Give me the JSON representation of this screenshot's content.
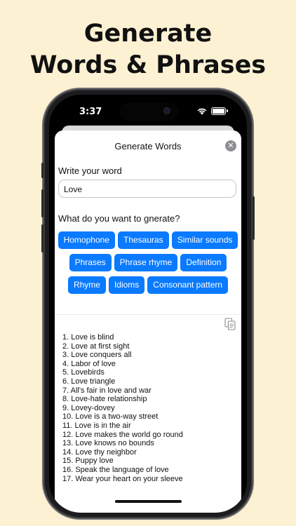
{
  "headline": {
    "line1": "Generate",
    "line2": "Words & Phrases"
  },
  "status_bar": {
    "time": "3:37",
    "icons": [
      "wifi-icon",
      "battery-icon"
    ]
  },
  "sheet": {
    "title": "Generate Words",
    "close_icon": "close-icon",
    "word_label": "Write your word",
    "word_value": "Love",
    "generate_label": "What do you want to gnerate?",
    "options_row1": [
      "Homophone",
      "Thesauras",
      "Similar sounds"
    ],
    "options_row2": [
      "Phrases",
      "Phrase rhyme",
      "Definition"
    ],
    "options_row3": [
      "Rhyme",
      "Idioms",
      "Consonant pattern"
    ],
    "copy_icon": "copy-icon",
    "results": [
      "1. Love is blind",
      "2. Love at first sight",
      "3. Love conquers all",
      "4. Labor of love",
      "5. Lovebirds",
      "6. Love triangle",
      "7. All's fair in love and war",
      "8. Love-hate relationship",
      "9. Lovey-dovey",
      "10. Love is a two-way street",
      "11. Love is in the air",
      "12. Love makes the world go round",
      "13. Love knows no bounds",
      "14. Love thy neighbor",
      "15. Puppy love",
      "16. Speak the language of love",
      "17. Wear your heart on your sleeve"
    ]
  },
  "colors": {
    "background": "#fdf1d3",
    "accent": "#0a7aff"
  }
}
